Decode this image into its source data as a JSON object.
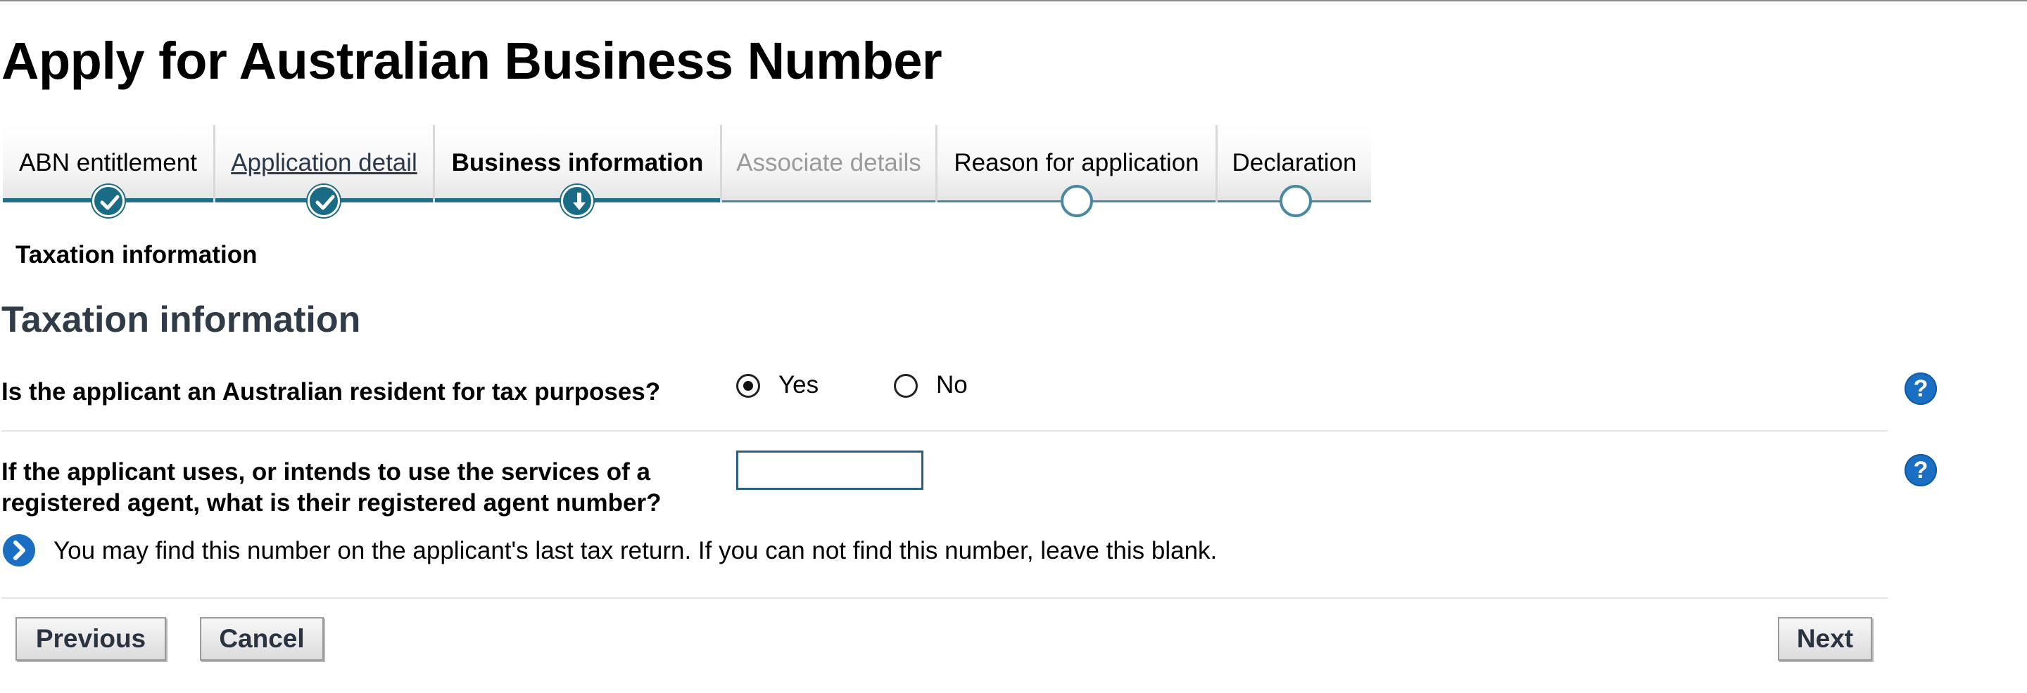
{
  "page": {
    "title": "Apply for Australian Business Number"
  },
  "stepper": {
    "steps": [
      {
        "label": "ABN entitlement",
        "state": "complete"
      },
      {
        "label": "Application detail",
        "state": "complete-link"
      },
      {
        "label": "Business information",
        "state": "current"
      },
      {
        "label": "Associate details",
        "state": "disabled"
      },
      {
        "label": "Reason for application",
        "state": "pending"
      },
      {
        "label": "Declaration",
        "state": "pending"
      }
    ]
  },
  "subheading": "Taxation information",
  "section": {
    "heading": "Taxation information"
  },
  "questions": {
    "resident": {
      "label": "Is the applicant an Australian resident for tax purposes?",
      "options": [
        "Yes",
        "No"
      ],
      "selected": "Yes"
    },
    "agent": {
      "label_line1": "If the applicant uses, or intends to use the services of a",
      "label_line2": "registered agent, what is their registered agent number?",
      "value": ""
    }
  },
  "hint": "You may find this number on the applicant's last tax return. If you can not find this number, leave this blank.",
  "help_glyph": "?",
  "buttons": {
    "previous": "Previous",
    "cancel": "Cancel",
    "next": "Next"
  },
  "colors": {
    "step_bar": "#1f6f8b",
    "help_icon": "#1b6fc2",
    "heading": "#2f3b47"
  },
  "icons": {
    "step_done": "check-circle-icon",
    "step_current": "download-arrow-icon",
    "step_pending": "empty-circle-icon",
    "help": "help-icon",
    "hint": "chevron-right-icon"
  }
}
